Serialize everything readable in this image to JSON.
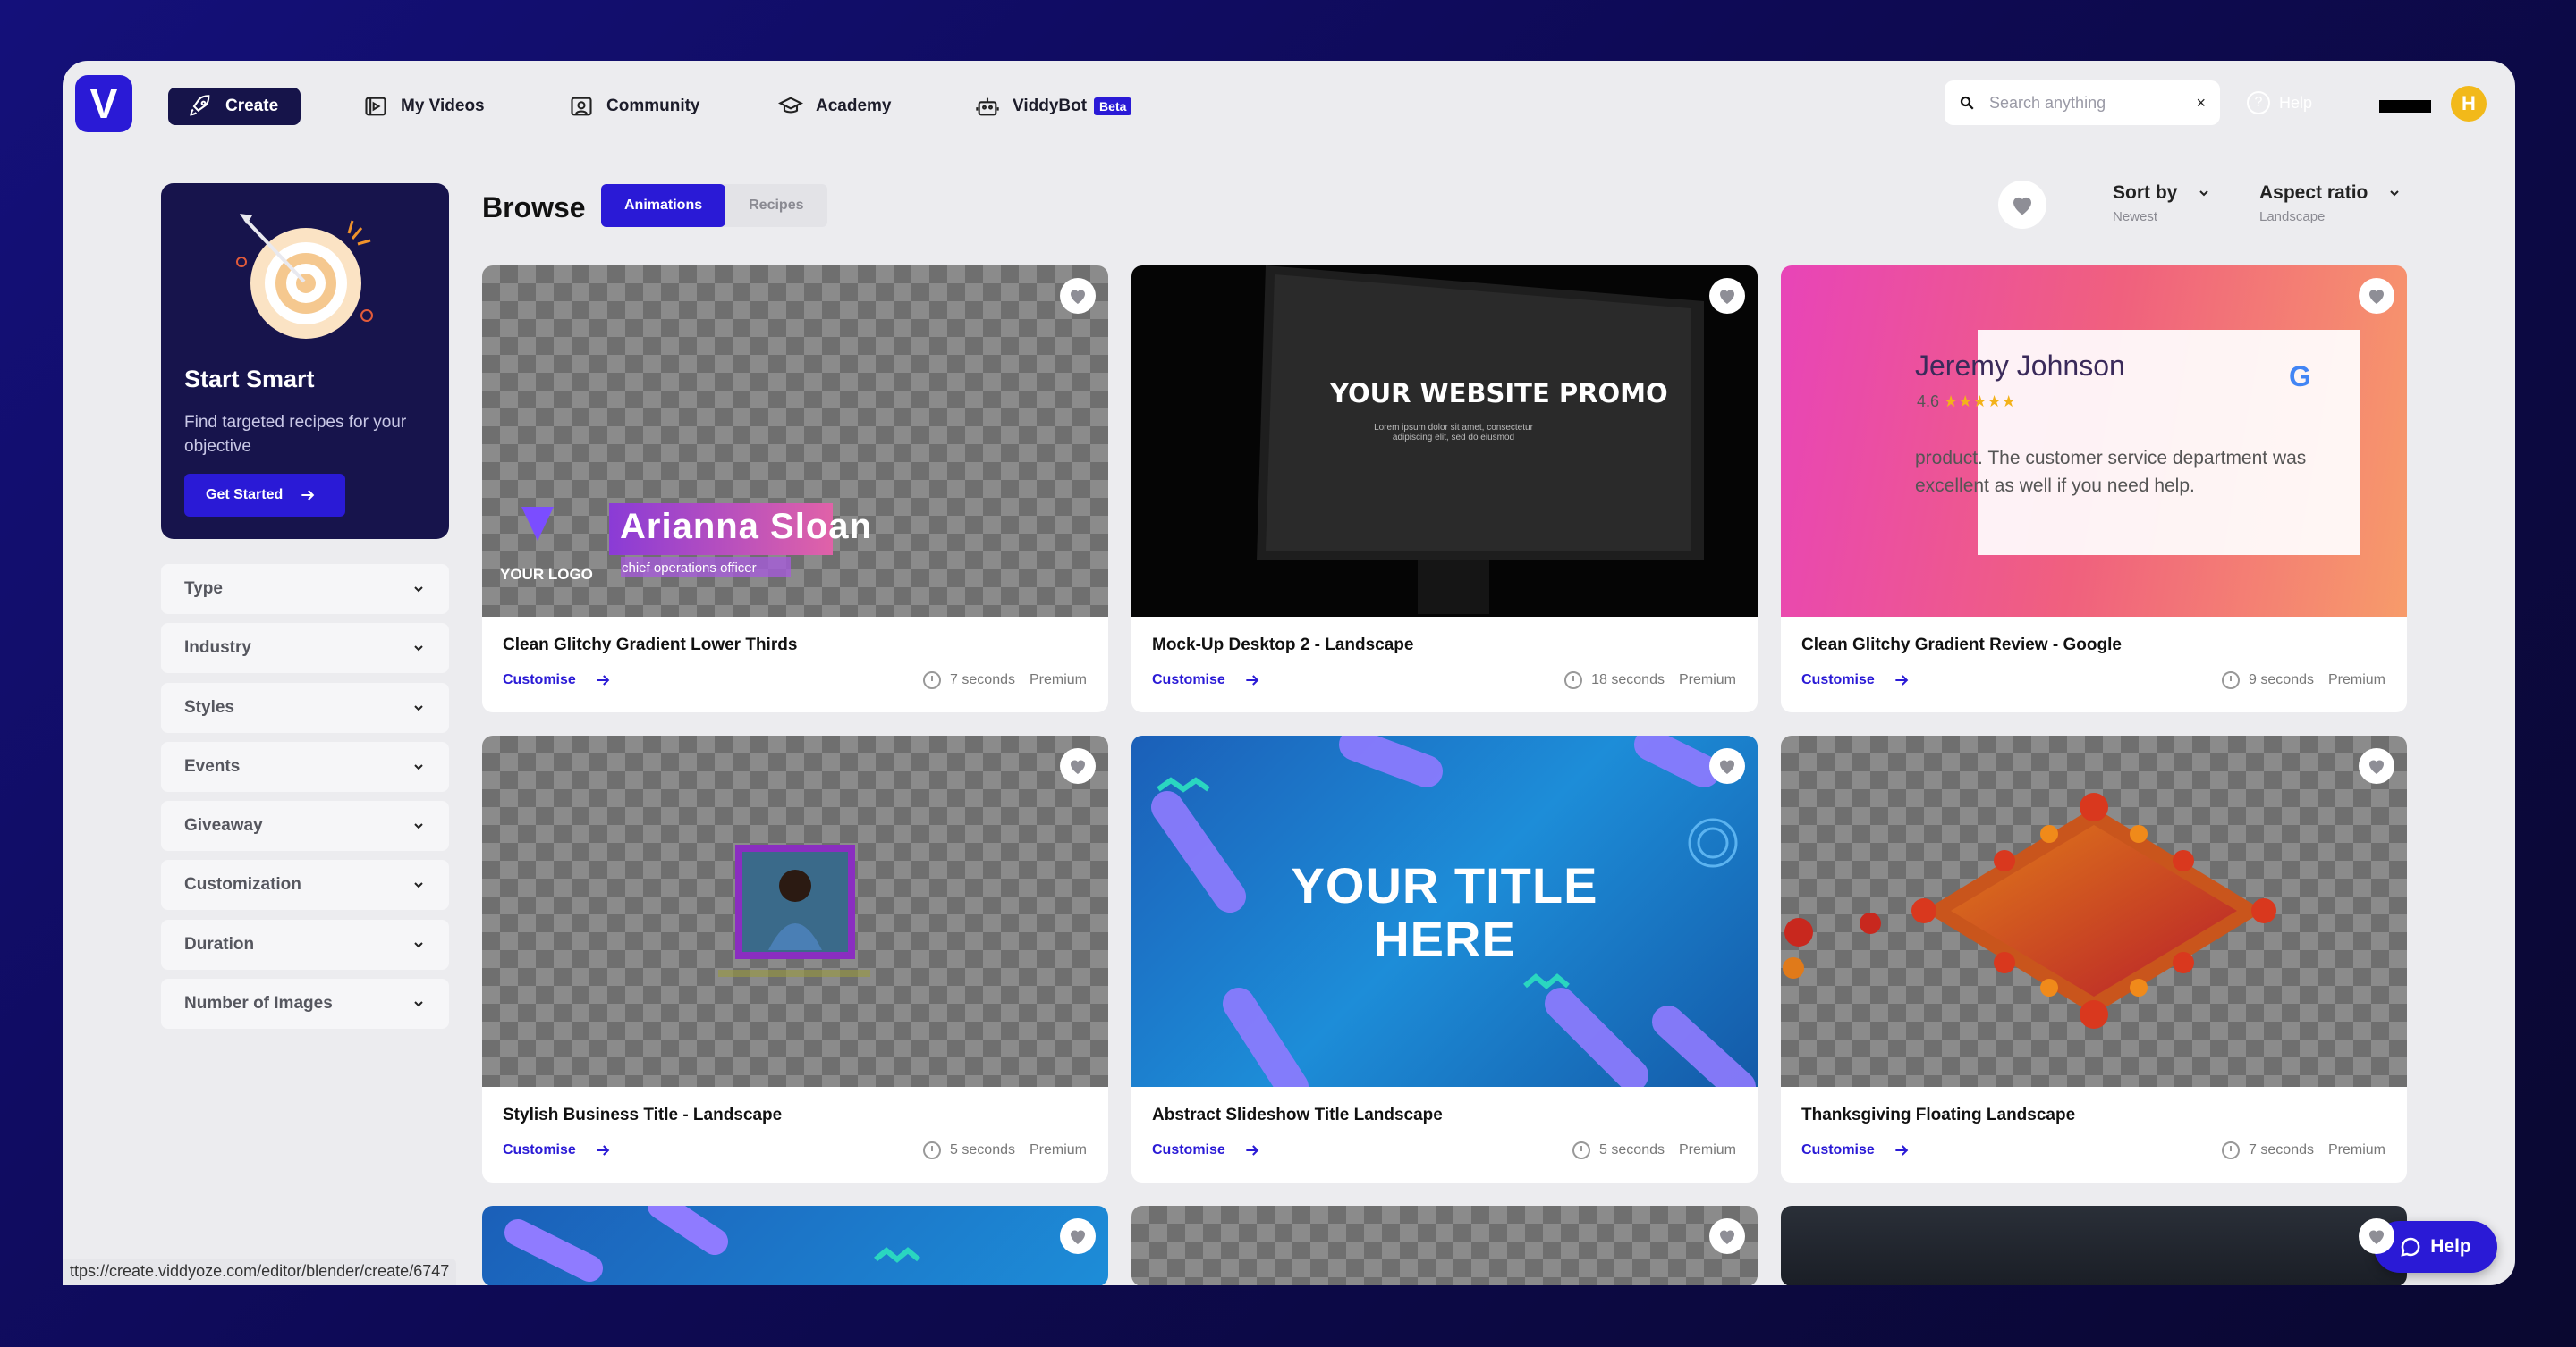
{
  "nav": {
    "logo": "V",
    "create": "Create",
    "my_videos": "My Videos",
    "community": "Community",
    "academy": "Academy",
    "viddybot": "ViddyBot",
    "beta": "Beta",
    "search_placeholder": "Search anything",
    "search_clear": "×",
    "help": "Help",
    "avatar": "H"
  },
  "promo": {
    "title": "Start Smart",
    "subtitle": "Find targeted recipes for your objective",
    "button": "Get Started"
  },
  "filters": [
    "Type",
    "Industry",
    "Styles",
    "Events",
    "Giveaway",
    "Customization",
    "Duration",
    "Number of Images"
  ],
  "browse": {
    "title": "Browse",
    "tabs": [
      "Animations",
      "Recipes"
    ],
    "sort_label": "Sort by",
    "sort_value": "Newest",
    "aspect_label": "Aspect ratio",
    "aspect_value": "Landscape"
  },
  "cards": [
    {
      "title": "Clean Glitchy Gradient Lower Thirds",
      "customise": "Customise",
      "duration": "7 seconds",
      "tier": "Premium",
      "art": {
        "logo_text": "YOUR LOGO",
        "name_text": "Arianna Sloan",
        "sub_text": "chief operations officer"
      }
    },
    {
      "title": "Mock-Up Desktop 2 - Landscape",
      "customise": "Customise",
      "duration": "18 seconds",
      "tier": "Premium",
      "art": {
        "headline": "YOUR WEBSITE PROMO",
        "sub": "Lorem ipsum dolor sit amet, consectetur adipiscing elit, sed do eiusmod"
      }
    },
    {
      "title": "Clean Glitchy Gradient Review - Google",
      "customise": "Customise",
      "duration": "9 seconds",
      "tier": "Premium",
      "art": {
        "reviewer": "Jeremy Johnson",
        "rating": "4.6",
        "stars": "★★★★★",
        "review": "product. The customer service department was excellent as well if you need help.",
        "g": "G"
      }
    },
    {
      "title": "Stylish Business Title - Landscape",
      "customise": "Customise",
      "duration": "5 seconds",
      "tier": "Premium"
    },
    {
      "title": "Abstract Slideshow Title Landscape",
      "customise": "Customise",
      "duration": "5 seconds",
      "tier": "Premium",
      "art": {
        "line1": "YOUR TITLE",
        "line2": "HERE"
      }
    },
    {
      "title": "Thanksgiving Floating Landscape",
      "customise": "Customise",
      "duration": "7 seconds",
      "tier": "Premium"
    }
  ],
  "status_url": "ttps://create.viddyoze.com/editor/blender/create/6747",
  "help_float": "Help",
  "colors": {
    "brand": "#2a1ad6",
    "navy": "#17144c",
    "background": "#ececef"
  }
}
